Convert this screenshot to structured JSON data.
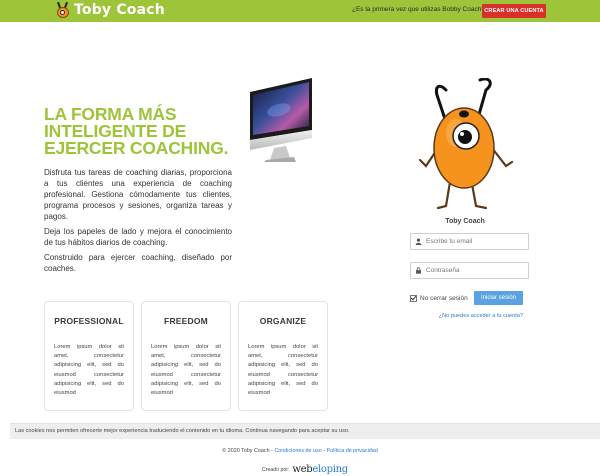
{
  "header": {
    "logo_text": "Toby Coach",
    "question": "¿Es la primera vez que utilizas Bobby Coach?",
    "create_account_label": "CREAR UNA CUENTA"
  },
  "hero": {
    "headline_lines": [
      "LA FORMA MÁS",
      "INTELIGENTE DE",
      "EJERCER COACHING."
    ],
    "paragraphs": [
      "Disfruta tus tareas de coaching diarias, proporciona a tus clientes una experiencia de coaching profesional. Gestiona cómodamente tus clientes, programa procesos y sesiones, organiza tareas y pagos.",
      "Deja los papeles de lado y mejora el conocimiento de tus hábitos diarios de coaching.",
      "Construido para ejercer coaching, diseñado por coaches."
    ]
  },
  "features": [
    {
      "title": "PROFESSIONAL",
      "text": "Lorem ipsum dolor sit amet, consectetur adipisicing elit, sed do eiusmod consectetur adipisicing elit, sed do eiusmod"
    },
    {
      "title": "FREEDOM",
      "text": "Lorem ipsum dolor sit amet, consectetur adipisicing elit, sed do eiusmod consectetur adipisicing elit, sed do eiusmod"
    },
    {
      "title": "ORGANIZE",
      "text": "Lorem ipsum dolor sit amet, consectetur adipisicing elit, sed do eiusmod consectetur adipisicing elit, sed do eiusmod"
    }
  ],
  "login": {
    "mascot_label": "Toby Coach",
    "email_placeholder": "Escribe tu email",
    "password_placeholder": "Contraseña",
    "remember_label": "No cerrar sesión",
    "remember_checked": true,
    "submit_label": "Iniciar sesión",
    "forgot_label": "¿No puedes acceder a tu cuenta?"
  },
  "cookie_text": "Las cookies nos permiten ofrecerte mejor experiencia traduciendo el contenido en tu idioma. Continua navegando para aceptar su uso.",
  "footer": {
    "copyright": "© 2020 Toby Coach - ",
    "terms_link": "Condiciones de uso",
    "separator": " - ",
    "privacy_link": "Política de privacidad",
    "credit_label": "Creado por:",
    "credit_brand_a": "web",
    "credit_brand_b": "eloping"
  },
  "colors": {
    "brand_green": "#9ec43a",
    "create_button": "#d9302b",
    "login_button": "#5aa3e0",
    "link_blue": "#2a7bd0",
    "mascot_orange": "#f6931f"
  },
  "icons": [
    "user-icon",
    "lock-icon",
    "check-icon"
  ]
}
